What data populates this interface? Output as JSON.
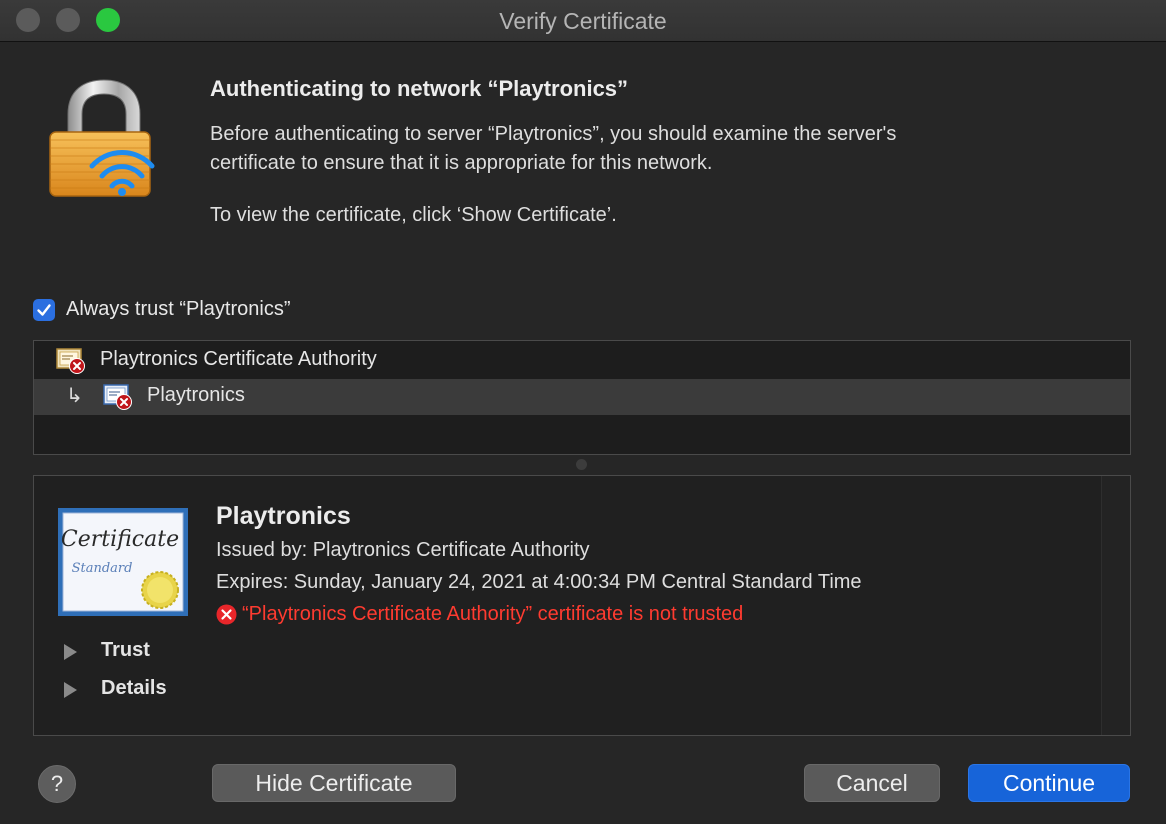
{
  "window": {
    "title": "Verify Certificate"
  },
  "header": {
    "heading": "Authenticating to network “Playtronics”",
    "message_line1": "Before authenticating to server “Playtronics”, you should examine the server's",
    "message_line2": "certificate to ensure that it is appropriate for this network.",
    "message_view": "To view the certificate, click ‘Show Certificate’."
  },
  "trust_option": {
    "label": "Always trust “Playtronics”",
    "checked": true
  },
  "chain": {
    "items": [
      {
        "label": "Playtronics Certificate Authority",
        "icon": "certificate-error-icon"
      },
      {
        "label": "Playtronics",
        "icon": "certificate-error-icon",
        "arrow": "↳",
        "selected": true
      }
    ]
  },
  "details": {
    "name": "Playtronics",
    "issued_by": "Issued by: Playtronics Certificate Authority",
    "expires": "Expires: Sunday, January 24, 2021 at 4:00:34 PM Central Standard Time",
    "error": "“Playtronics Certificate Authority” certificate is not trusted",
    "cert_word": "Certificate",
    "cert_sub": "Standard",
    "sections": [
      {
        "label": "Trust"
      },
      {
        "label": "Details"
      }
    ]
  },
  "footer": {
    "help_label": "?",
    "hide_label": "Hide Certificate",
    "cancel_label": "Cancel",
    "continue_label": "Continue"
  },
  "colors": {
    "accent": "#1764d9",
    "error": "#ff3b30",
    "zoom_button": "#2ac840"
  }
}
